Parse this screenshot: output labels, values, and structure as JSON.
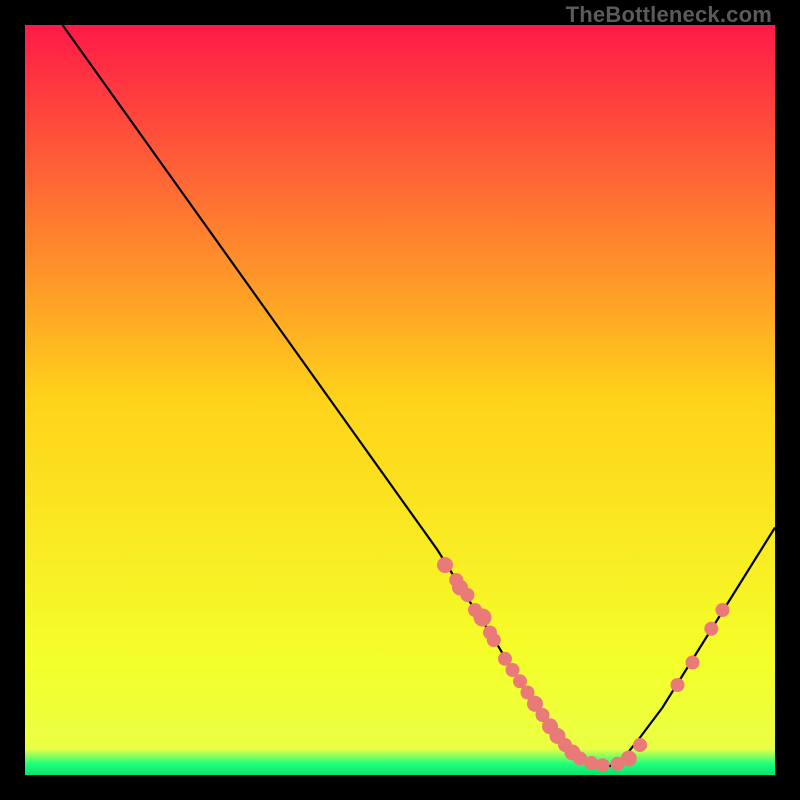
{
  "watermark": "TheBottleneck.com",
  "chart_data": {
    "type": "line",
    "title": "",
    "xlabel": "",
    "ylabel": "",
    "xlim": [
      0,
      100
    ],
    "ylim": [
      0,
      100
    ],
    "grid": false,
    "legend": false,
    "gradient_stops": [
      {
        "offset": 0.0,
        "color": "#ff1a48"
      },
      {
        "offset": 0.5,
        "color": "#ffd31a"
      },
      {
        "offset": 0.85,
        "color": "#f4ff2a"
      },
      {
        "offset": 0.965,
        "color": "#eaff45"
      },
      {
        "offset": 0.985,
        "color": "#20ff7b"
      },
      {
        "offset": 1.0,
        "color": "#00e66b"
      }
    ],
    "series": [
      {
        "name": "bottleneck-curve",
        "color": "#000000",
        "x": [
          5,
          10,
          15,
          20,
          25,
          30,
          35,
          40,
          45,
          50,
          55,
          60,
          62,
          65,
          68,
          70,
          72,
          74,
          76,
          78,
          80,
          82,
          85,
          90,
          95,
          100
        ],
        "y": [
          100,
          93,
          86,
          79,
          72,
          65,
          58,
          51,
          44,
          37,
          30,
          22,
          19,
          14,
          9,
          6,
          4,
          2.2,
          1.3,
          1.2,
          2.5,
          5,
          9,
          17,
          25,
          33
        ]
      }
    ],
    "scatter_points": {
      "name": "data-points",
      "color": "#ea7a77",
      "radius_default": 7,
      "points": [
        {
          "x": 56,
          "y": 28,
          "r": 8
        },
        {
          "x": 57.5,
          "y": 26,
          "r": 7
        },
        {
          "x": 58,
          "y": 25,
          "r": 8
        },
        {
          "x": 59,
          "y": 24,
          "r": 7
        },
        {
          "x": 60,
          "y": 22,
          "r": 7
        },
        {
          "x": 61,
          "y": 21,
          "r": 9
        },
        {
          "x": 62,
          "y": 19,
          "r": 7
        },
        {
          "x": 62.5,
          "y": 18,
          "r": 7
        },
        {
          "x": 64,
          "y": 15.5,
          "r": 7
        },
        {
          "x": 65,
          "y": 14,
          "r": 7
        },
        {
          "x": 66,
          "y": 12.5,
          "r": 7
        },
        {
          "x": 67,
          "y": 11,
          "r": 7
        },
        {
          "x": 68,
          "y": 9.5,
          "r": 8
        },
        {
          "x": 69,
          "y": 8,
          "r": 7
        },
        {
          "x": 70,
          "y": 6.5,
          "r": 8
        },
        {
          "x": 71,
          "y": 5.2,
          "r": 8
        },
        {
          "x": 72,
          "y": 4,
          "r": 7
        },
        {
          "x": 73,
          "y": 3,
          "r": 8
        },
        {
          "x": 74,
          "y": 2.2,
          "r": 7
        },
        {
          "x": 75.5,
          "y": 1.6,
          "r": 7
        },
        {
          "x": 77,
          "y": 1.3,
          "r": 7
        },
        {
          "x": 79,
          "y": 1.5,
          "r": 7
        },
        {
          "x": 80.5,
          "y": 2.2,
          "r": 8
        },
        {
          "x": 82,
          "y": 4,
          "r": 7
        },
        {
          "x": 87,
          "y": 12,
          "r": 7
        },
        {
          "x": 89,
          "y": 15,
          "r": 7
        },
        {
          "x": 91.5,
          "y": 19.5,
          "r": 7
        },
        {
          "x": 93,
          "y": 22,
          "r": 7
        }
      ]
    }
  }
}
